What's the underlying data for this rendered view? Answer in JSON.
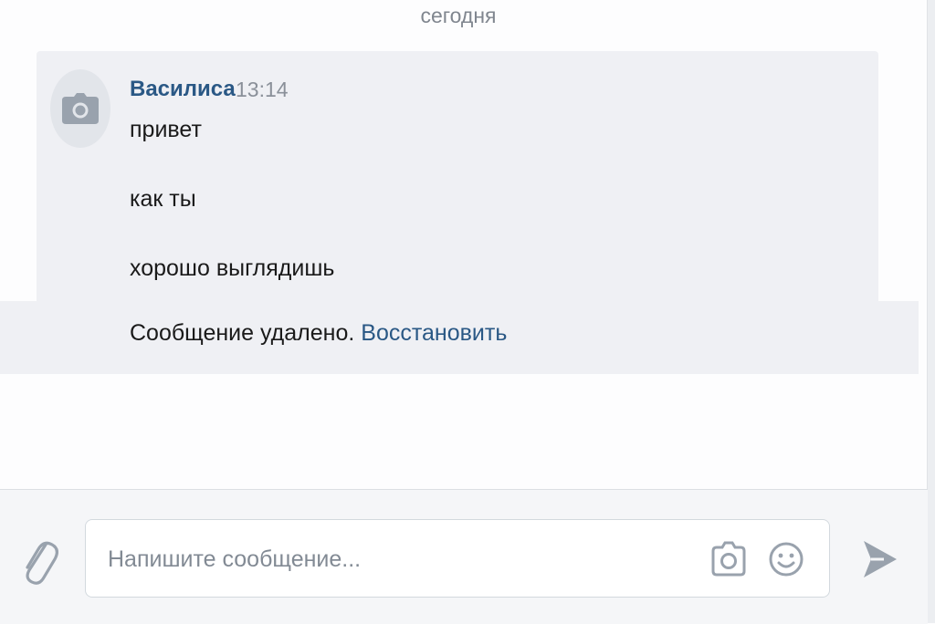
{
  "chat": {
    "date_separator": "сегодня",
    "group": {
      "author": "Василиса",
      "time": "13:14",
      "avatar_icon": "camera-icon",
      "messages": [
        "привет",
        "как ты",
        "хорошо выглядишь"
      ]
    },
    "deleted": {
      "text": "Сообщение удалено.",
      "restore_label": "Восстановить"
    }
  },
  "composer": {
    "placeholder": "Напишите сообщение...",
    "value": "",
    "icons": {
      "attach": "paperclip-icon",
      "camera": "camera-icon",
      "emoji": "smile-icon",
      "send": "send-icon"
    }
  },
  "colors": {
    "link": "#2a5885",
    "bubble_bg": "#eff0f4",
    "icon_gray": "#99a2ad"
  }
}
